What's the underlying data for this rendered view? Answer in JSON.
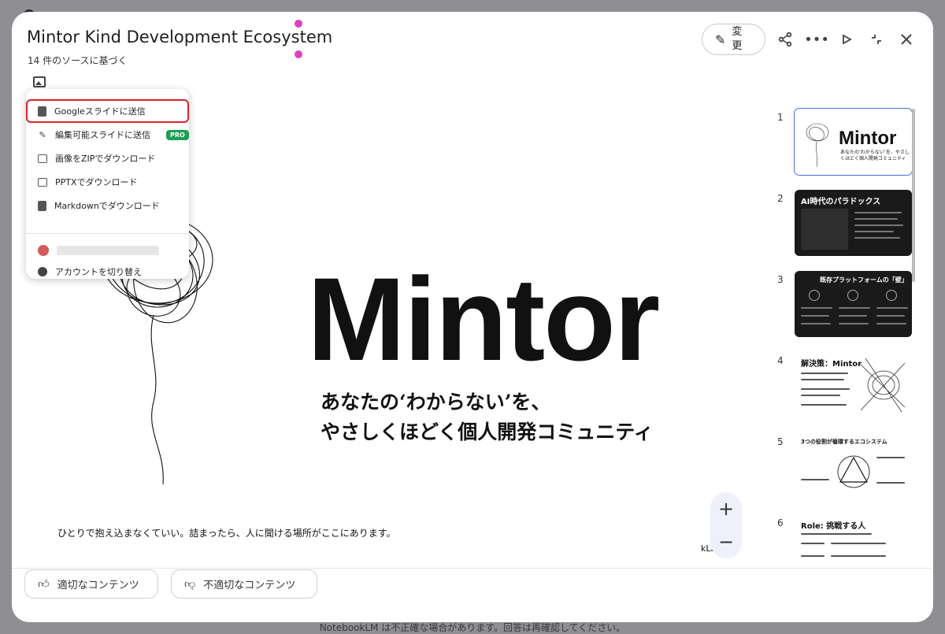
{
  "header": {
    "title": "Mintor Kind Development Ecosystem",
    "subtitle": "14 件のソースに基づく",
    "edit_label": "変更",
    "icons": [
      "share-icon",
      "more-icon",
      "play-icon",
      "collapse-icon",
      "close-icon"
    ]
  },
  "menu": {
    "items": [
      {
        "label": "Googleスライドに送信",
        "icon": "slides-icon"
      },
      {
        "label": "編集可能スライドに送信",
        "icon": "pencil-icon",
        "badge": "PRO"
      },
      {
        "label": "画像をZIPでダウンロード",
        "icon": "image-icon"
      },
      {
        "label": "PPTXでダウンロード",
        "icon": "pptx-icon"
      },
      {
        "label": "Markdownでダウンロード",
        "icon": "document-icon"
      }
    ],
    "switch_account": "アカウントを切り替え"
  },
  "slide": {
    "title": "Mintor",
    "tagline_1": "あなたの‘わからない’を、",
    "tagline_2": "やさしくほどく個人開発コミュニティ",
    "footer_text": "ひとりで抱え込まなくていい。詰まったら、人に聞ける場所がここにあります。",
    "brand": "kLM"
  },
  "zoom": {
    "in": "+",
    "out": "−"
  },
  "thumbnails": [
    {
      "num": "1",
      "title": "Mintor",
      "sub": "あなたの‘わからない’を、やさしくほどく個人開発コミュニティ"
    },
    {
      "num": "2",
      "title": "AI時代のパラドックス"
    },
    {
      "num": "3",
      "title": "既存プラットフォームの「壁」"
    },
    {
      "num": "4",
      "title": "解決策：Mintor"
    },
    {
      "num": "5",
      "title": "3つの役割が循環するエコシステム"
    },
    {
      "num": "6",
      "title": "Role: 挑戦する人"
    }
  ],
  "feedback": {
    "good": "適切なコンテンツ",
    "bad": "不適切なコンテンツ"
  },
  "disclaimer": "NotebookLM は不正確な場合があります。回答は再確認してください。"
}
